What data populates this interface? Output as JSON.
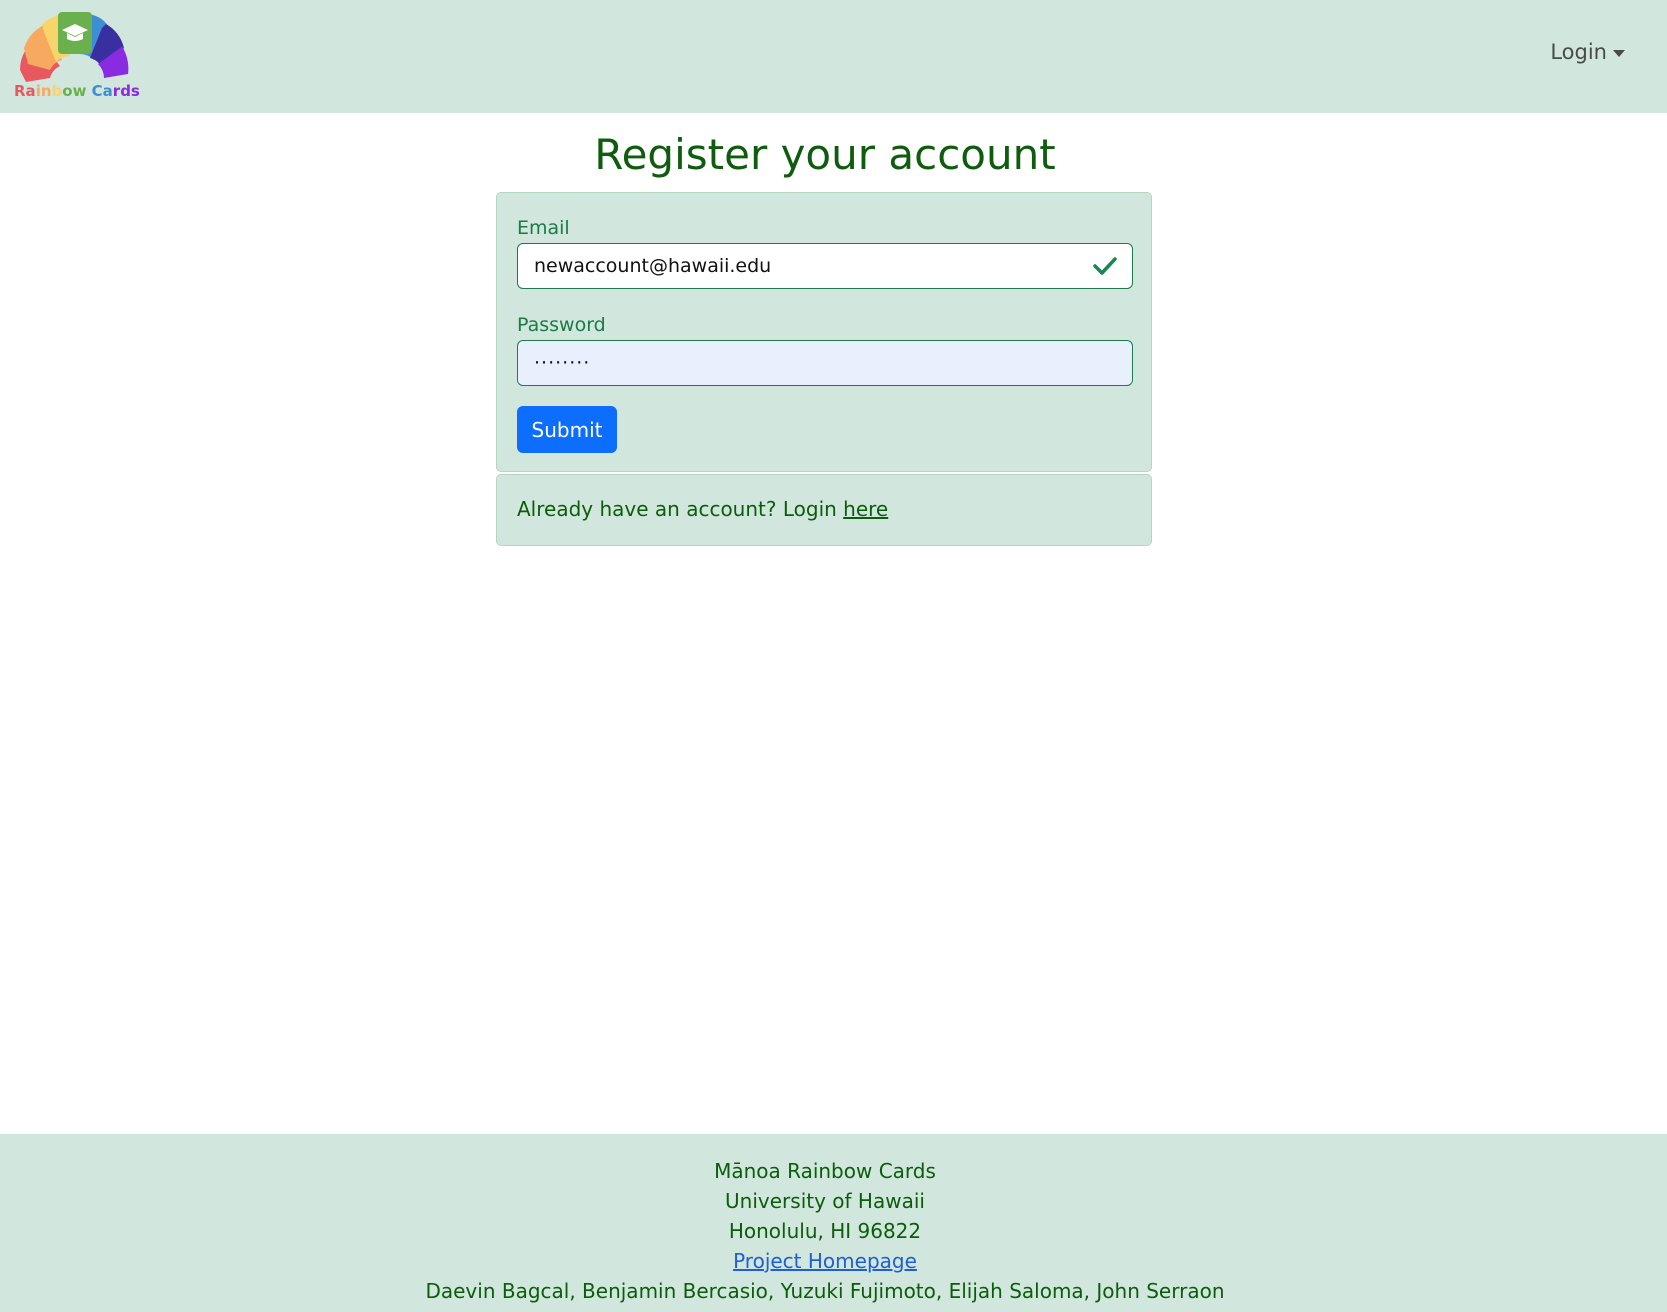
{
  "navbar": {
    "brand_text_parts": [
      "Ra",
      "in",
      "b",
      "ow",
      " Ca",
      "rds"
    ],
    "login_label": "Login"
  },
  "page": {
    "title": "Register your account"
  },
  "form": {
    "email_label": "Email",
    "email_value": "newaccount@hawaii.edu",
    "password_label": "Password",
    "password_value": "········",
    "submit_label": "Submit"
  },
  "alt_login": {
    "prompt": "Already have an account? Login ",
    "link_label": "here"
  },
  "footer": {
    "line1": "Mānoa Rainbow Cards",
    "line2": "University of Hawaii",
    "line3": "Honolulu, HI 96822",
    "homepage_link": "Project Homepage",
    "authors": "Daevin Bagcal, Benjamin Bercasio, Yuzuki Fujimoto, Elijah Saloma, John Serraon"
  },
  "colors": {
    "header_bg": "#d1e7dd",
    "title_green": "#0f5c0f",
    "submit_blue": "#0d6efd",
    "link_blue": "#1f5fd6"
  },
  "icons": {
    "brand": "rainbow-cards-logo",
    "valid": "check-icon",
    "dropdown": "caret-down-icon"
  }
}
